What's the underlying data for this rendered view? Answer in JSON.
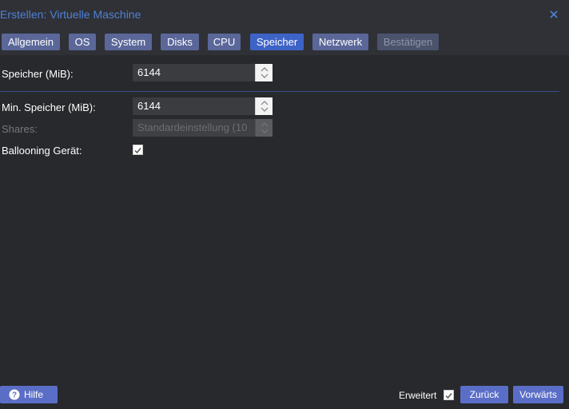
{
  "window": {
    "title": "Erstellen: Virtuelle Maschine",
    "close_icon": "close-icon"
  },
  "tabs": [
    {
      "label": "Allgemein",
      "state": "normal"
    },
    {
      "label": "OS",
      "state": "normal"
    },
    {
      "label": "System",
      "state": "normal"
    },
    {
      "label": "Disks",
      "state": "normal"
    },
    {
      "label": "CPU",
      "state": "normal"
    },
    {
      "label": "Speicher",
      "state": "active"
    },
    {
      "label": "Netzwerk",
      "state": "normal"
    },
    {
      "label": "Bestätigen",
      "state": "disabled"
    }
  ],
  "form": {
    "memory_label": "Speicher (MiB):",
    "memory_value": "6144",
    "min_memory_label": "Min. Speicher (MiB):",
    "min_memory_value": "6144",
    "shares_label": "Shares:",
    "shares_value": "Standardeinstellung (10",
    "ballooning_label": "Ballooning Gerät:",
    "ballooning_checked": true
  },
  "footer": {
    "help_label": "Hilfe",
    "advanced_label": "Erweitert",
    "advanced_checked": true,
    "back_label": "Zurück",
    "next_label": "Vorwärts"
  },
  "colors": {
    "accent": "#3e63c6",
    "button": "#5b6ec7",
    "title": "#4f80d6",
    "background": "#27292c"
  }
}
